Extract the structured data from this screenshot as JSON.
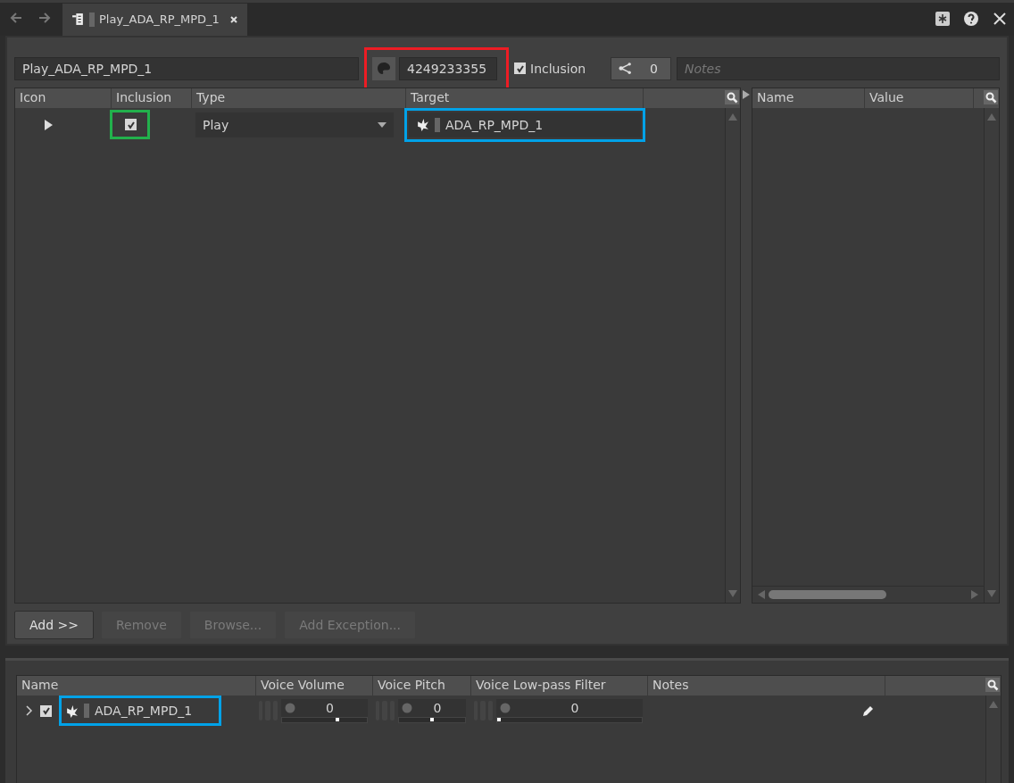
{
  "tab": {
    "title": "Play_ADA_RP_MPD_1",
    "selected": true
  },
  "header": {
    "name": "Play_ADA_RP_MPD_1",
    "id": "4249233355",
    "id_highlight": {
      "color": "#ed1c24"
    },
    "inclusion": {
      "label": "Inclusion",
      "checked": true
    },
    "references": "0",
    "notes_placeholder": "Notes"
  },
  "actions_table": {
    "columns": [
      "Icon",
      "Inclusion",
      "Type",
      "Target"
    ],
    "rows": [
      {
        "inclusion": true,
        "inclusion_highlight": {
          "color": "#22b14c"
        },
        "type": "Play",
        "target": "ADA_RP_MPD_1",
        "target_highlight": {
          "color": "#00a2e8"
        }
      }
    ]
  },
  "properties_table": {
    "columns": [
      "Name",
      "Value"
    ]
  },
  "buttons": [
    {
      "label": "Add >>",
      "disabled": false
    },
    {
      "label": "Remove",
      "disabled": true
    },
    {
      "label": "Browse...",
      "disabled": true
    },
    {
      "label": "Add Exception...",
      "disabled": true
    }
  ],
  "objects_table": {
    "columns": [
      "Name",
      "Voice Volume",
      "Voice Pitch",
      "Voice Low-pass Filter",
      "Notes"
    ],
    "rows": [
      {
        "included": true,
        "name": "ADA_RP_MPD_1",
        "name_highlight": {
          "color": "#00a2e8"
        },
        "sliders": [
          {
            "value": "0",
            "level": 0.66
          },
          {
            "value": "0",
            "level": 0.5
          },
          {
            "value": "0",
            "level": 0
          }
        ]
      }
    ]
  }
}
